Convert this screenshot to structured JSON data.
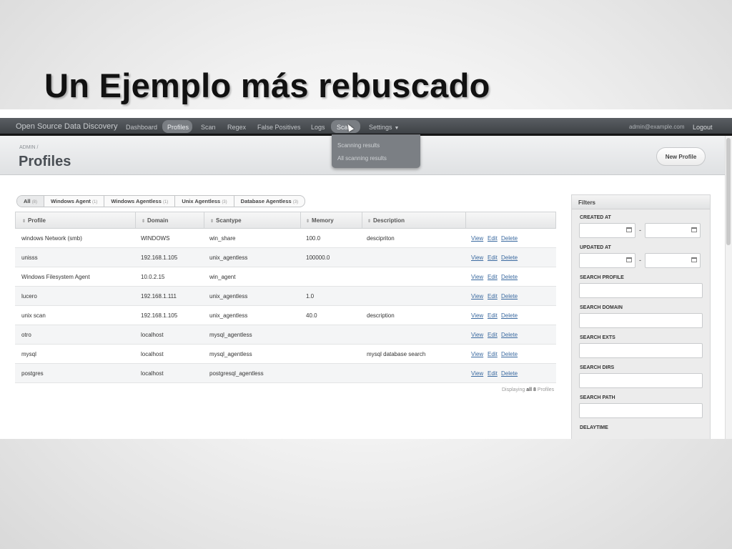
{
  "slide": {
    "title": "Un Ejemplo más rebuscado"
  },
  "nav": {
    "brand": "Open Source Data Discovery",
    "items": [
      "Dashboard",
      "Profiles",
      "Scan",
      "Regex",
      "False Positives",
      "Logs",
      "Scan",
      "Settings"
    ],
    "user": "admin@example.com",
    "logout": "Logout"
  },
  "dropdown": {
    "items": [
      "Scanning results",
      "All scanning results"
    ]
  },
  "header": {
    "breadcrumb": "ADMIN /",
    "title": "Profiles",
    "new_button": "New Profile"
  },
  "tabs": [
    {
      "label": "All",
      "count": "(8)"
    },
    {
      "label": "Windows Agent",
      "count": "(1)"
    },
    {
      "label": "Windows Agentless",
      "count": "(1)"
    },
    {
      "label": "Unix Agentless",
      "count": "(3)"
    },
    {
      "label": "Database Agentless",
      "count": "(3)"
    }
  ],
  "table": {
    "headers": [
      "Profile",
      "Domain",
      "Scantype",
      "Memory",
      "Description"
    ],
    "rows": [
      [
        "windows Network (smb)",
        "WINDOWS",
        "win_share",
        "100.0",
        "descipriton"
      ],
      [
        "unisss",
        "192.168.1.105",
        "unix_agentless",
        "100000.0",
        ""
      ],
      [
        "Windows Filesystem Agent",
        "10.0.2.15",
        "win_agent",
        "",
        ""
      ],
      [
        "lucero",
        "192.168.1.111",
        "unix_agentless",
        "1.0",
        ""
      ],
      [
        "unix scan",
        "192.168.1.105",
        "unix_agentless",
        "40.0",
        "description"
      ],
      [
        "otro",
        "localhost",
        "mysql_agentless",
        "",
        ""
      ],
      [
        "mysql",
        "localhost",
        "mysql_agentless",
        "",
        "mysql database search"
      ],
      [
        "postgres",
        "localhost",
        "postgresql_agentless",
        "",
        ""
      ]
    ],
    "actions": [
      "View",
      "Edit",
      "Delete"
    ]
  },
  "footer": {
    "prefix": "Displaying",
    "bold": "all 8",
    "suffix": "Profiles"
  },
  "filters": {
    "title": "Filters",
    "created_at": "CREATED AT",
    "updated_at": "UPDATED AT",
    "range_sep": "-",
    "search_profile": "SEARCH PROFILE",
    "search_domain": "SEARCH DOMAIN",
    "search_exts": "SEARCH EXTS",
    "search_dirs": "SEARCH DIRS",
    "search_path": "SEARCH PATH",
    "delaytime": "DELAYTIME"
  }
}
